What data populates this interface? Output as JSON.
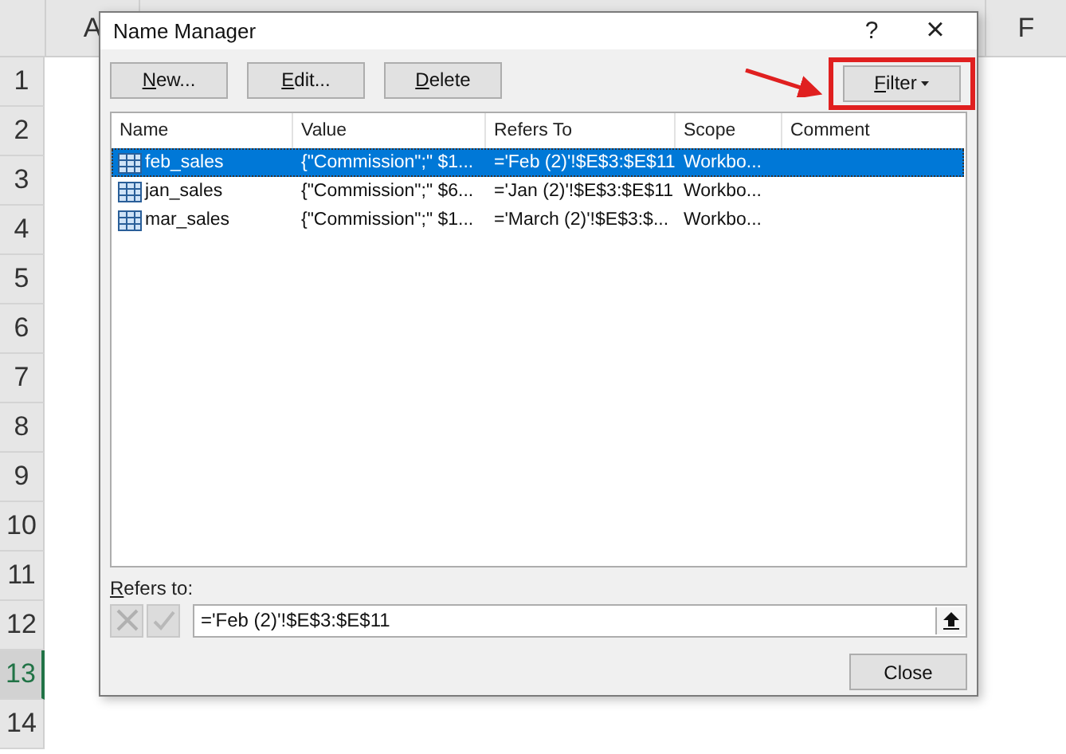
{
  "sheet": {
    "columns": [
      "A",
      "F"
    ],
    "rows": [
      {
        "label": "1",
        "selected": false
      },
      {
        "label": "2",
        "selected": false
      },
      {
        "label": "3",
        "selected": false
      },
      {
        "label": "4",
        "selected": false
      },
      {
        "label": "5",
        "selected": false
      },
      {
        "label": "6",
        "selected": false
      },
      {
        "label": "7",
        "selected": false
      },
      {
        "label": "8",
        "selected": false
      },
      {
        "label": "9",
        "selected": false
      },
      {
        "label": "10",
        "selected": false
      },
      {
        "label": "11",
        "selected": false
      },
      {
        "label": "12",
        "selected": false
      },
      {
        "label": "13",
        "selected": true
      },
      {
        "label": "14",
        "selected": false
      }
    ]
  },
  "dialog": {
    "title": "Name Manager",
    "help": "?",
    "close_glyph": "×",
    "buttons": [
      {
        "key": "N",
        "rest": "ew..."
      },
      {
        "key": "E",
        "rest": "dit..."
      },
      {
        "key": "D",
        "rest": "elete"
      }
    ],
    "filter": {
      "key": "F",
      "rest": "ilter",
      "highlighted": true
    },
    "table": {
      "columns": [
        "Name",
        "Value",
        "Refers To",
        "Scope",
        "Comment"
      ],
      "rows": [
        {
          "selected": true,
          "cells": [
            "feb_sales",
            "{\"Commission\";\" $1...",
            "='Feb (2)'!$E$3:$E$11",
            "Workbo..."
          ]
        },
        {
          "selected": false,
          "cells": [
            "jan_sales",
            "{\"Commission\";\" $6...",
            "='Jan (2)'!$E$3:$E$11",
            "Workbo..."
          ]
        },
        {
          "selected": false,
          "cells": [
            "mar_sales",
            "{\"Commission\";\" $1...",
            "='March (2)'!$E$3:$...",
            "Workbo..."
          ]
        }
      ]
    },
    "refers_to": {
      "label_key": "R",
      "label_rest": "efers to:",
      "value": "='Feb (2)'!$E$3:$E$11"
    },
    "close_button": "Close"
  }
}
